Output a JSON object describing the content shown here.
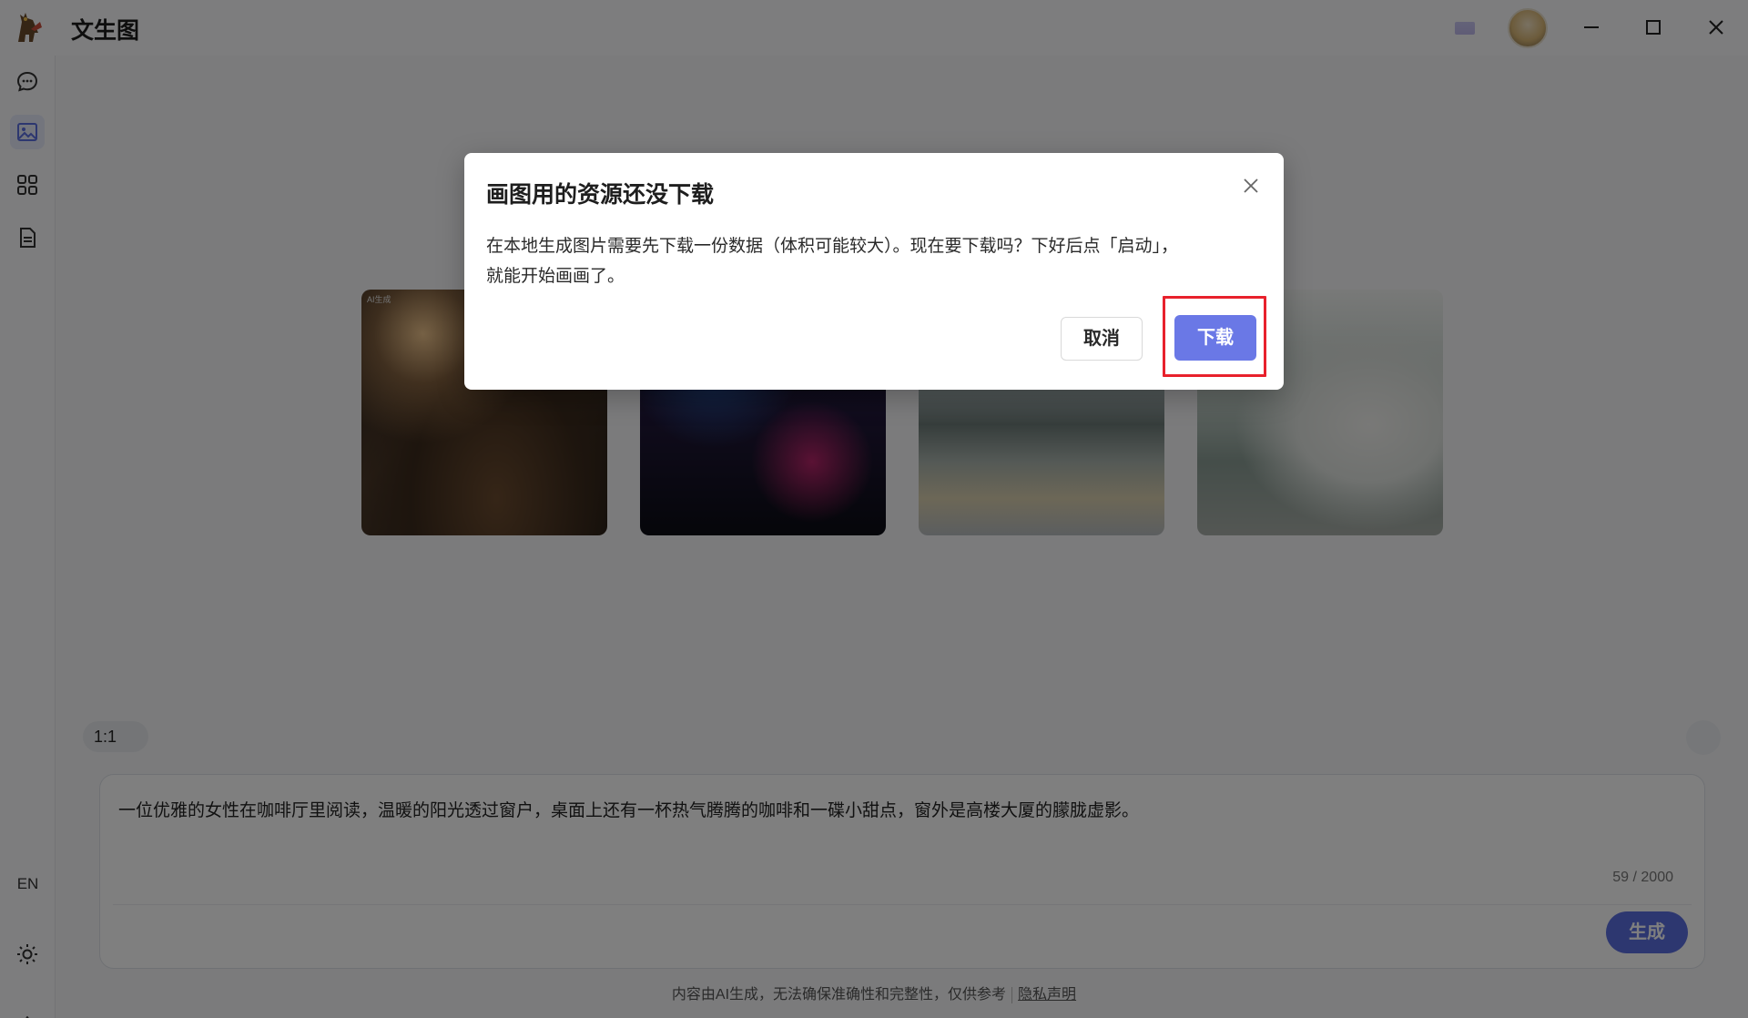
{
  "window": {
    "title": "文生图"
  },
  "sidebar": {
    "items": [
      {
        "name": "chat",
        "icon": "chat-bubble-icon"
      },
      {
        "name": "image",
        "icon": "image-icon",
        "active": true
      },
      {
        "name": "apps",
        "icon": "grid-icon"
      },
      {
        "name": "docs",
        "icon": "document-icon"
      }
    ],
    "lang_label": "EN",
    "theme_icon": "sun-icon",
    "settings_icon": "gear-icon"
  },
  "main": {
    "gallery_tag": "AI生成",
    "aspect_ratio": "1:1",
    "prompt": {
      "text": "一位优雅的女性在咖啡厅里阅读，温暖的阳光透过窗户，桌面上还有一杯热气腾腾的咖啡和一碟小甜点，窗外是高楼大厦的朦胧虚影。",
      "count": "59 / 2000"
    },
    "generate_label": "生成",
    "footer_note": "内容由AI生成，无法确保准确性和完整性，仅供参考",
    "privacy_link": "隐私声明"
  },
  "dialog": {
    "title": "画图用的资源还没下载",
    "body_line1": "在本地生成图片需要先下载一份数据（体积可能较大）。现在要下载吗？下好后点「启动」，",
    "body_line2": "就能开始画画了。",
    "cancel_label": "取消",
    "download_label": "下载"
  },
  "colors": {
    "accent": "#6a78e6",
    "highlight": "#e8212c"
  }
}
